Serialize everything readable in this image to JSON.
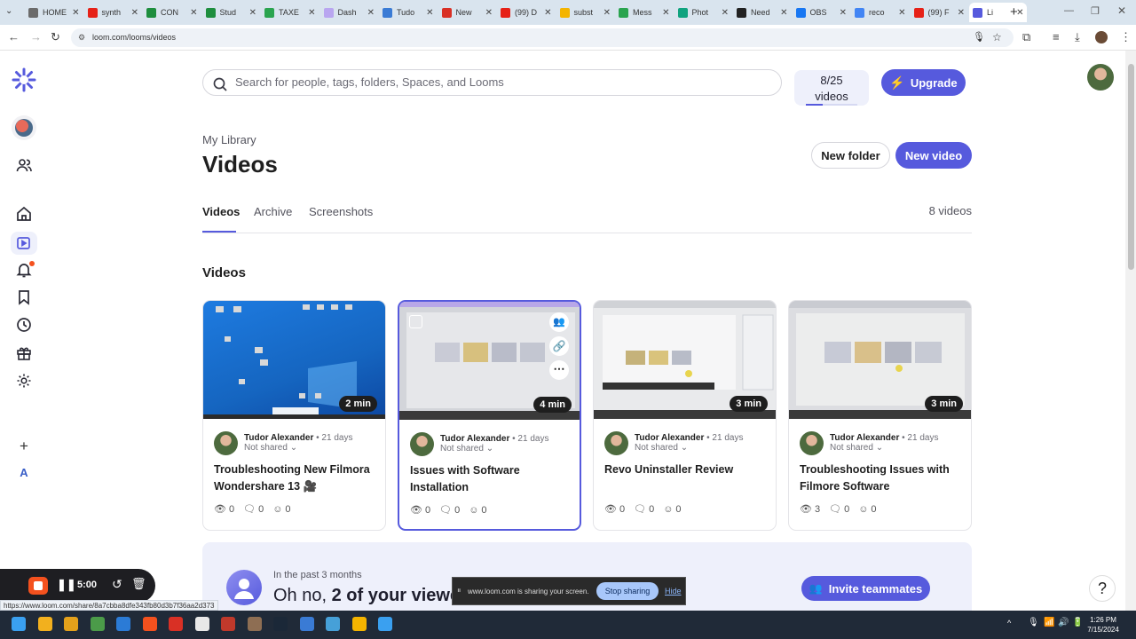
{
  "browser": {
    "tabs": [
      {
        "label": "HOME",
        "color": "#6b6b6b"
      },
      {
        "label": "synth",
        "color": "#e62117"
      },
      {
        "label": "CON",
        "color": "#1e8e3e"
      },
      {
        "label": "Stud",
        "color": "#1e8e3e"
      },
      {
        "label": "TAXE",
        "color": "#2aa44f"
      },
      {
        "label": "Dash",
        "color": "#b9a6f0"
      },
      {
        "label": "Tudo",
        "color": "#3a7bd5"
      },
      {
        "label": "New",
        "color": "#d93025"
      },
      {
        "label": "(99) D",
        "color": "#e62117"
      },
      {
        "label": "subst",
        "color": "#f4b400"
      },
      {
        "label": "Mess",
        "color": "#2aa44f"
      },
      {
        "label": "Phot",
        "color": "#10a37f"
      },
      {
        "label": "Need",
        "color": "#222222"
      },
      {
        "label": "OBS",
        "color": "#1877f2"
      },
      {
        "label": "reco",
        "color": "#4285f4"
      },
      {
        "label": "(99) F",
        "color": "#e62117"
      },
      {
        "label": "Li",
        "color": "#565add"
      }
    ],
    "url": "loom.com/looms/videos",
    "status_url": "https://www.loom.com/share/8a7cbba8dfe343fb80d3b7f36aa2d373"
  },
  "search": {
    "placeholder": "Search for people, tags, folders, Spaces, and Looms"
  },
  "quota": {
    "count": "8/25",
    "unit": "videos",
    "used_fraction": 0.32
  },
  "upgrade_label": "Upgrade",
  "breadcrumb": "My Library",
  "page_title": "Videos",
  "actions": {
    "new_folder": "New folder",
    "new_video": "New video"
  },
  "content_tabs": [
    {
      "label": "Videos",
      "active": true
    },
    {
      "label": "Archive",
      "active": false
    },
    {
      "label": "Screenshots",
      "active": false
    }
  ],
  "video_count": "8 videos",
  "section_title": "Videos",
  "videos": [
    {
      "duration": "2 min",
      "author": "Tudor Alexander",
      "age": "21 days",
      "sharing": "Not shared",
      "title": "Troubleshooting New Filmora Wondershare 13 🎥",
      "views": "0",
      "comments": "0",
      "reactions": "0"
    },
    {
      "duration": "4 min",
      "author": "Tudor Alexander",
      "age": "21 days",
      "sharing": "Not shared",
      "title": "Issues with Software Installation",
      "views": "0",
      "comments": "0",
      "reactions": "0"
    },
    {
      "duration": "3 min",
      "author": "Tudor Alexander",
      "age": "21 days",
      "sharing": "Not shared",
      "title": "Revo Uninstaller Review",
      "views": "0",
      "comments": "0",
      "reactions": "0"
    },
    {
      "duration": "3 min",
      "author": "Tudor Alexander",
      "age": "21 days",
      "sharing": "Not shared",
      "title": "Troubleshooting Issues with Filmore Software",
      "views": "3",
      "comments": "0",
      "reactions": "0"
    }
  ],
  "banner": {
    "eyebrow": "In the past 3 months",
    "headline_prefix": "Oh no, ",
    "headline_bold": "2 of your viewer",
    "invite_label": "Invite teammates"
  },
  "recorder": {
    "time": "5:00"
  },
  "share_notice": {
    "text": "www.loom.com is sharing your screen.",
    "stop": "Stop sharing",
    "hide": "Hide"
  },
  "rail": {
    "workspace_initial": "A"
  },
  "taskbar": {
    "time": "1:26 PM",
    "date": "7/15/2024"
  },
  "colors": {
    "accent": "#565add",
    "accent_light": "#eef0fb",
    "recording": "#f4511e"
  }
}
